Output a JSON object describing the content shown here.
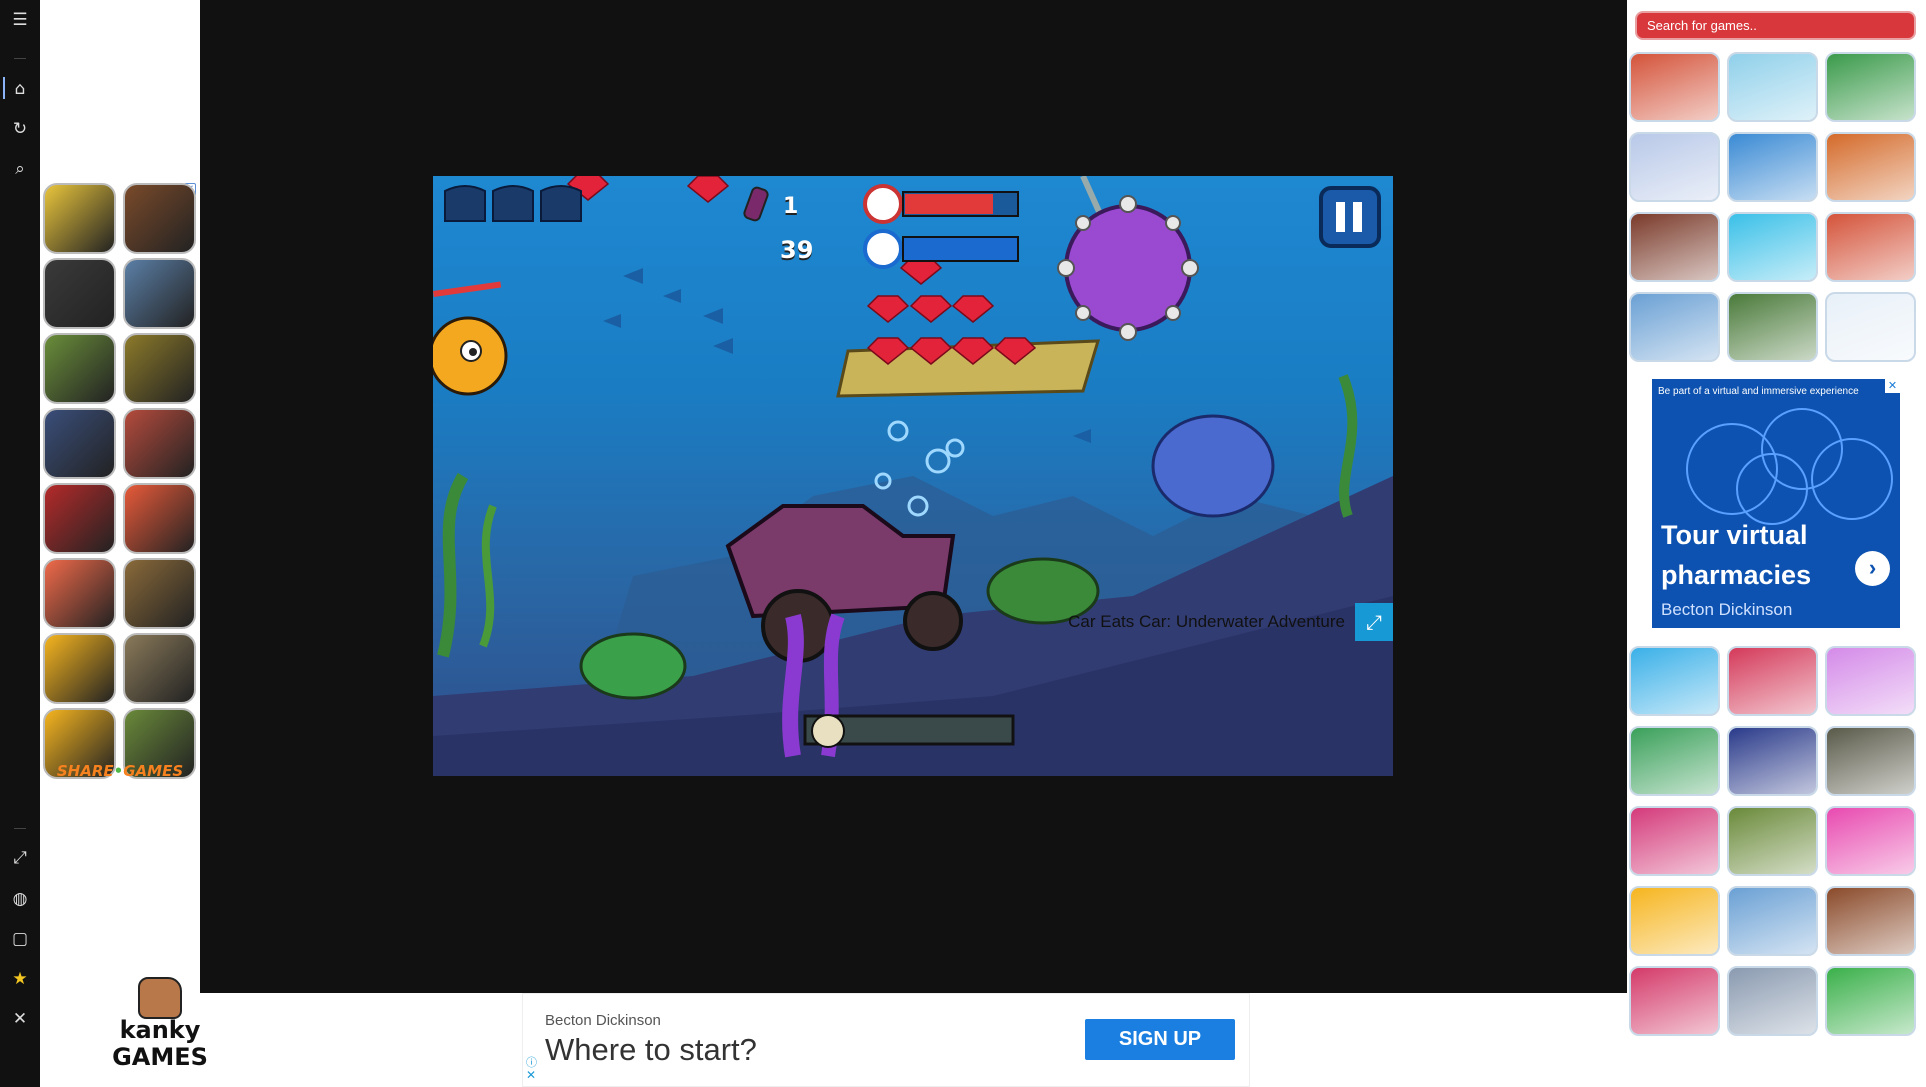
{
  "sidebar": {
    "icons": [
      {
        "name": "menu-icon",
        "glyph": "☰"
      },
      {
        "name": "home-icon",
        "glyph": "⌂"
      },
      {
        "name": "history-icon",
        "glyph": "↻"
      },
      {
        "name": "search-icon",
        "glyph": "⌕"
      },
      {
        "name": "expand-icon",
        "glyph": "⤢"
      },
      {
        "name": "globe-icon",
        "glyph": "◍"
      },
      {
        "name": "bag-icon",
        "glyph": "▢"
      },
      {
        "name": "star-icon",
        "glyph": "★"
      },
      {
        "name": "close-icon",
        "glyph": "✕"
      }
    ],
    "star_color": "#f3c622"
  },
  "left_ad": {
    "brand": "SHARE GAMES",
    "tiles": [
      {
        "name": "subway-surfers-tile",
        "color": "#e9c53c"
      },
      {
        "name": "fnaf-tile",
        "color": "#7a4a2a"
      },
      {
        "name": "granny-tile",
        "color": "#3a3a3a"
      },
      {
        "name": "pubg-tile",
        "color": "#5b7fa6"
      },
      {
        "name": "minecraft-tile",
        "color": "#6a8e3a"
      },
      {
        "name": "temple-run-tile",
        "color": "#8c7a2a"
      },
      {
        "name": "fortnite-tile",
        "color": "#3a4e7a"
      },
      {
        "name": "scary-teacher-tile",
        "color": "#b54b3d"
      },
      {
        "name": "spinner-tile",
        "color": "#b52a2a"
      },
      {
        "name": "baby-tile",
        "color": "#e85a3a"
      },
      {
        "name": "mouth-tile",
        "color": "#f06a4a"
      },
      {
        "name": "sniper-tile",
        "color": "#8a6a3a"
      },
      {
        "name": "brawl-tile",
        "color": "#f6b51f"
      },
      {
        "name": "gta-tile",
        "color": "#8a7a5a"
      },
      {
        "name": "among-us-tile",
        "color": "#f6b51f"
      },
      {
        "name": "shooter-tile",
        "color": "#6a8a3a"
      }
    ]
  },
  "logo": {
    "line1": "kanky",
    "line2": "GAMES"
  },
  "game": {
    "title": "Car Eats Car: Underwater Adventure",
    "hud": {
      "ammo": "1",
      "gems": "39"
    }
  },
  "right": {
    "search_placeholder": "Search for games..",
    "top_tiles": [
      {
        "name": "blocky-roads-tile",
        "color": "#d4533a"
      },
      {
        "name": "buggy-skate-tile",
        "color": "#8fd0ea"
      },
      {
        "name": "block-tower-tile",
        "color": "#3a9a4a"
      },
      {
        "name": "fairy-tile",
        "color": "#b8c8e8"
      },
      {
        "name": "runner-tile",
        "color": "#3a8ad4"
      },
      {
        "name": "candy-tile",
        "color": "#d46a2a"
      },
      {
        "name": "pixel-fighter-tile",
        "color": "#7a3a2a"
      },
      {
        "name": "soccer-tile",
        "color": "#3ac0e8"
      },
      {
        "name": "brawler-tile",
        "color": "#d4533a"
      },
      {
        "name": "plane-tile",
        "color": "#6aa0d4"
      },
      {
        "name": "zombie-tile",
        "color": "#4a7a3a"
      },
      {
        "name": "nonogram-tile",
        "color": "#e8f0f8"
      }
    ],
    "ad": {
      "tagline": "Be part of a virtual and immersive experience",
      "headline": "Tour virtual pharmacies",
      "brand": "Becton Dickinson"
    },
    "bottom_tiles": [
      {
        "name": "island-tile",
        "color": "#3ab0e8"
      },
      {
        "name": "dress-up-tile",
        "color": "#d43a5a"
      },
      {
        "name": "poop-tile",
        "color": "#d48ae8"
      },
      {
        "name": "2048-tile",
        "color": "#3aa05a"
      },
      {
        "name": "pac-chef-tile",
        "color": "#2a3a8a"
      },
      {
        "name": "maze-tile",
        "color": "#5a5a4a"
      },
      {
        "name": "squid-tile",
        "color": "#d43a7a"
      },
      {
        "name": "war-tile",
        "color": "#6a8a3a"
      },
      {
        "name": "pink-tile",
        "color": "#e84ab0"
      },
      {
        "name": "chicken-egg-tile",
        "color": "#f6b51f"
      },
      {
        "name": "truck-tile",
        "color": "#6aa0d4"
      },
      {
        "name": "wood-puzzle-tile",
        "color": "#8a4a2a"
      },
      {
        "name": "fruit-tile",
        "color": "#d43a6a"
      },
      {
        "name": "viking-tile",
        "color": "#8a9ab0"
      },
      {
        "name": "red-ball-tile",
        "color": "#3ab04a"
      }
    ]
  },
  "bottom_ad": {
    "brand": "Becton Dickinson",
    "headline": "Where to start?",
    "cta": "SIGN UP"
  }
}
